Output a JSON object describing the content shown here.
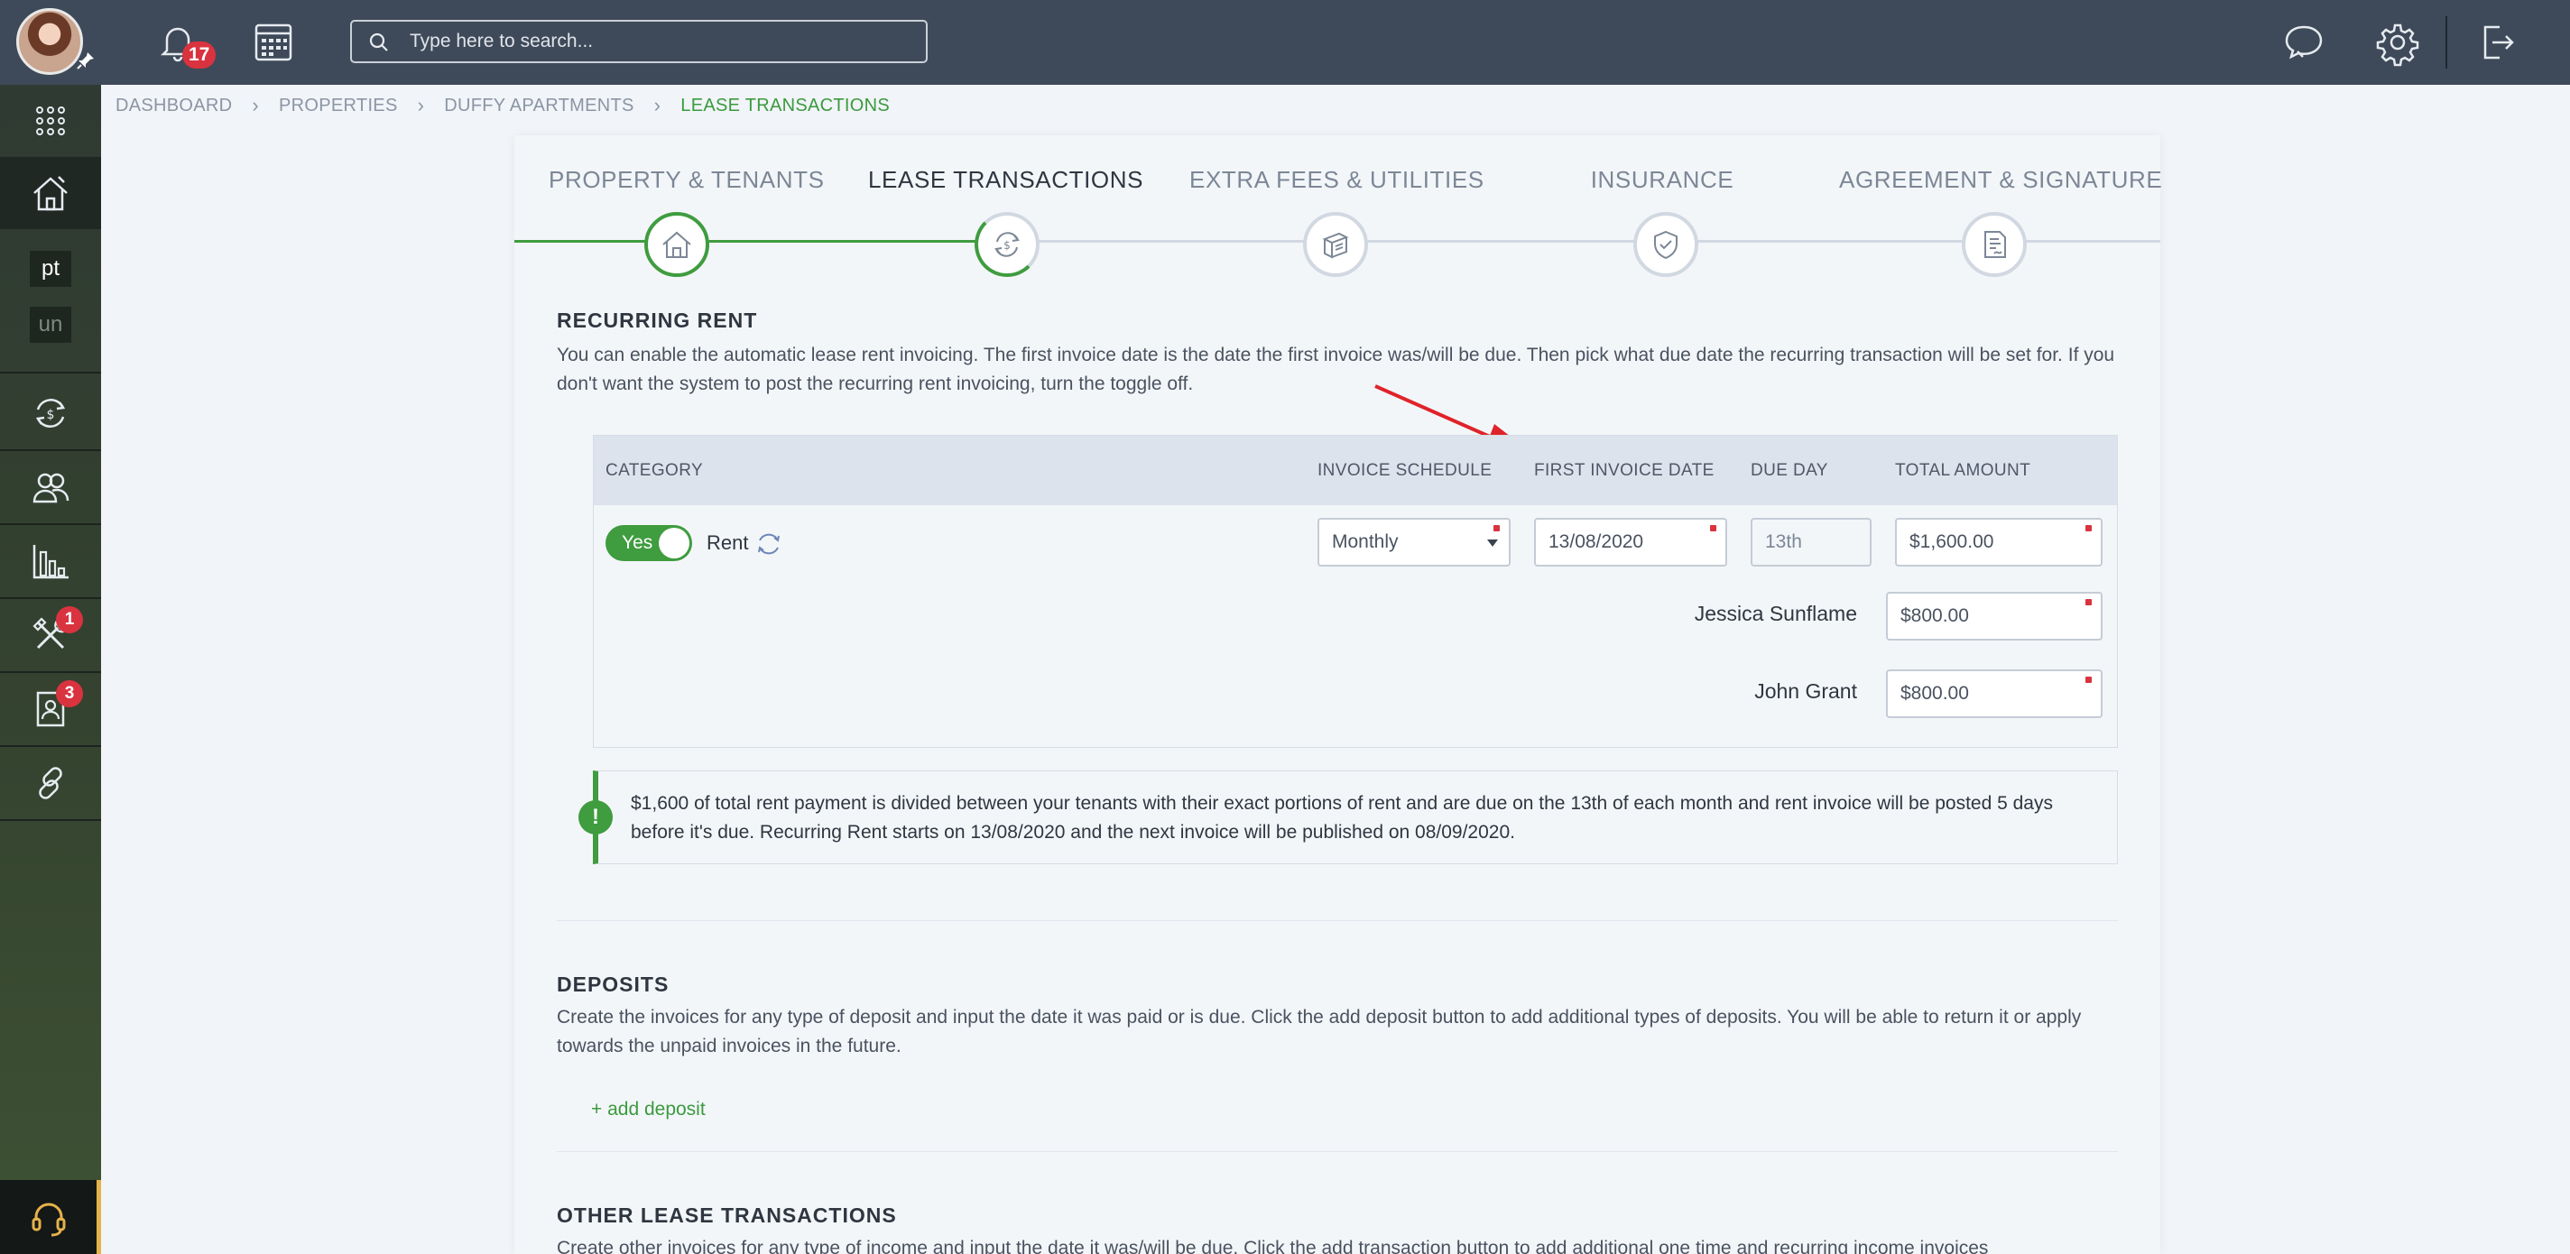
{
  "topbar": {
    "notifications_count": "17",
    "search_placeholder": "Type here to search..."
  },
  "sidebar": {
    "text_items": [
      "pt",
      "un"
    ],
    "badges": {
      "tools": "1",
      "contacts": "3"
    }
  },
  "breadcrumb": {
    "items": [
      "DASHBOARD",
      "PROPERTIES",
      "DUFFY APARTMENTS",
      "LEASE TRANSACTIONS"
    ]
  },
  "stepper": {
    "steps": [
      {
        "label": "PROPERTY & TENANTS",
        "icon": "house-icon"
      },
      {
        "label": "LEASE TRANSACTIONS",
        "icon": "dollar-cycle-icon"
      },
      {
        "label": "EXTRA FEES & UTILITIES",
        "icon": "bills-icon"
      },
      {
        "label": "INSURANCE",
        "icon": "shield-icon"
      },
      {
        "label": "AGREEMENT & SIGNATURE",
        "icon": "document-sign-icon"
      }
    ],
    "active_step": 2
  },
  "recurring_rent": {
    "title": "RECURRING RENT",
    "description": "You can enable the automatic lease rent invoicing. The first invoice date is the date the first invoice was/will be due. Then pick what due date the recurring transaction will be set for. If you don't want the system to post the recurring rent invoicing, turn the toggle off.",
    "table": {
      "headers": {
        "category": "CATEGORY",
        "schedule": "INVOICE SCHEDULE",
        "first_date": "FIRST INVOICE DATE",
        "due_day": "DUE DAY",
        "total": "TOTAL AMOUNT"
      },
      "toggle_label": "Yes",
      "category": "Rent",
      "schedule": "Monthly",
      "first_date": "13/08/2020",
      "due_day": "13th",
      "total": "$1,600.00",
      "tenants": [
        {
          "name": "Jessica Sunflame",
          "amount": "$800.00"
        },
        {
          "name": "John Grant",
          "amount": "$800.00"
        }
      ]
    },
    "info": "$1,600 of total rent payment is divided between your tenants with their exact portions of rent and are due on the 13th of each month and rent invoice will be posted 5 days before it's due. Recurring Rent starts on 13/08/2020 and the next invoice will be published on 08/09/2020."
  },
  "deposits": {
    "title": "DEPOSITS",
    "description": "Create the invoices for any type of deposit and input the date it was paid or is due. Click the add deposit button to add additional types of deposits. You will be able to return it or apply towards the unpaid invoices in the future.",
    "add_label": "+ add deposit"
  },
  "other": {
    "title": "OTHER LEASE TRANSACTIONS",
    "description": "Create other invoices for any type of income and input the date it was/will be due. Click the add transaction button to add additional one time and recurring income invoices"
  },
  "colors": {
    "accent": "#3b9a3e",
    "topbar": "#3e4a59",
    "badge": "#d9333f",
    "arrow": "#e0232a"
  }
}
